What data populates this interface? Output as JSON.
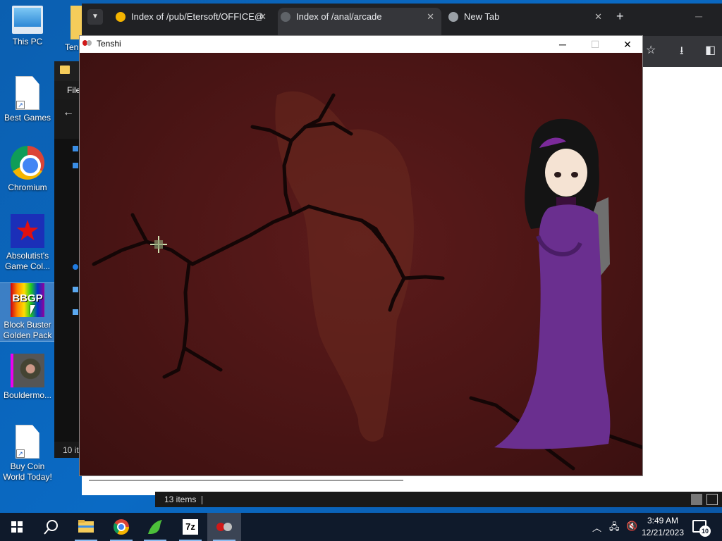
{
  "desktop": {
    "icons": [
      {
        "label": "This PC",
        "icon": "this-pc-icon"
      },
      {
        "label": "Best Games",
        "icon": "file-shortcut-icon"
      },
      {
        "label": "Chromium",
        "icon": "chromium-icon"
      },
      {
        "label": "Absolutist's Game Col...",
        "icon": "absolutist-icon"
      },
      {
        "label": "Block Buster Golden Pack",
        "icon": "bbgp-icon",
        "badge": "BBGP"
      },
      {
        "label": "Bouldermo...",
        "icon": "bouldermouse-icon"
      },
      {
        "label": "Buy Coin World Today!",
        "icon": "file-shortcut-icon"
      }
    ],
    "partial_icon_label": "Ten"
  },
  "browser": {
    "tabs": [
      {
        "title": "Index of /pub/Etersoft/OFFICE@",
        "active": false
      },
      {
        "title": "Index of /anal/arcade",
        "active": true
      },
      {
        "title": "New Tab",
        "active": false
      }
    ],
    "close_glyph": "✕",
    "new_tab_glyph": "+"
  },
  "explorer": {
    "ribbon_label": "File",
    "items_count_partial": "10 it",
    "status_items": "13 items"
  },
  "game_window": {
    "title": "Tenshi",
    "min_glyph": "─",
    "max_glyph": "☐",
    "close_glyph": "✕"
  },
  "taskbar": {
    "apps": [
      "start",
      "search",
      "file-explorer",
      "chrome",
      "dragon-app",
      "7zip",
      "tenshi"
    ],
    "seven_zip_label": "7z",
    "time": "3:49 AM",
    "date": "12/21/2023",
    "notification_count": "10"
  },
  "colors": {
    "taskbar": "#0f1a2b",
    "game_background": "#4b1515",
    "dress": "#6a2f8f"
  }
}
